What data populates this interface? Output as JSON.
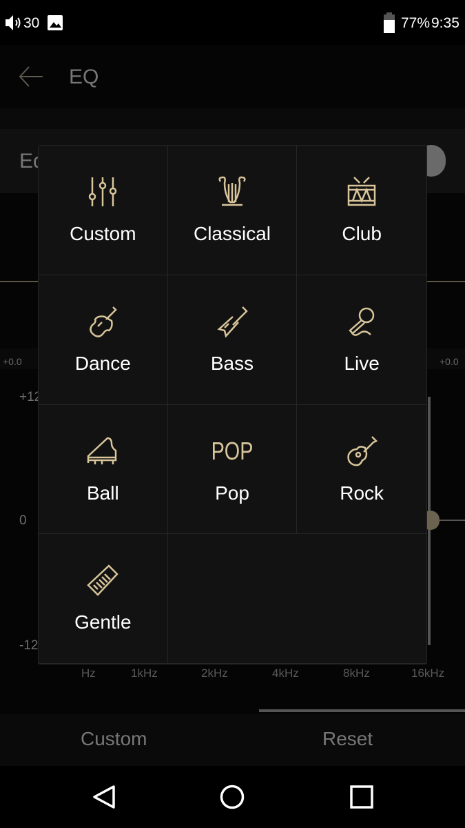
{
  "status_bar": {
    "volume": "30",
    "battery": "77%",
    "time": "9:35"
  },
  "toolbar": {
    "title": "EQ"
  },
  "eq_row": {
    "label_partial": "Eq"
  },
  "eq": {
    "left_db": "+0.0",
    "right_db": "+0.0",
    "y_top": "+12",
    "y_mid": "0",
    "y_bottom": "-12",
    "freqs": [
      "Hz",
      "1kHz",
      "2kHz",
      "4kHz",
      "8kHz",
      "16kHz"
    ]
  },
  "bottom": {
    "custom": "Custom",
    "reset": "Reset"
  },
  "accent": "#d8c59b",
  "presets": [
    {
      "label": "Custom",
      "icon": "sliders-icon"
    },
    {
      "label": "Classical",
      "icon": "lyre-icon"
    },
    {
      "label": "Club",
      "icon": "drum-icon"
    },
    {
      "label": "Dance",
      "icon": "violin-icon"
    },
    {
      "label": "Bass",
      "icon": "electric-guitar-icon"
    },
    {
      "label": "Live",
      "icon": "microphone-icon"
    },
    {
      "label": "Ball",
      "icon": "piano-icon"
    },
    {
      "label": "Pop",
      "icon": "pop-text-icon",
      "icon_text": "POP"
    },
    {
      "label": "Rock",
      "icon": "acoustic-guitar-icon"
    },
    {
      "label": "Gentle",
      "icon": "zither-icon"
    }
  ]
}
